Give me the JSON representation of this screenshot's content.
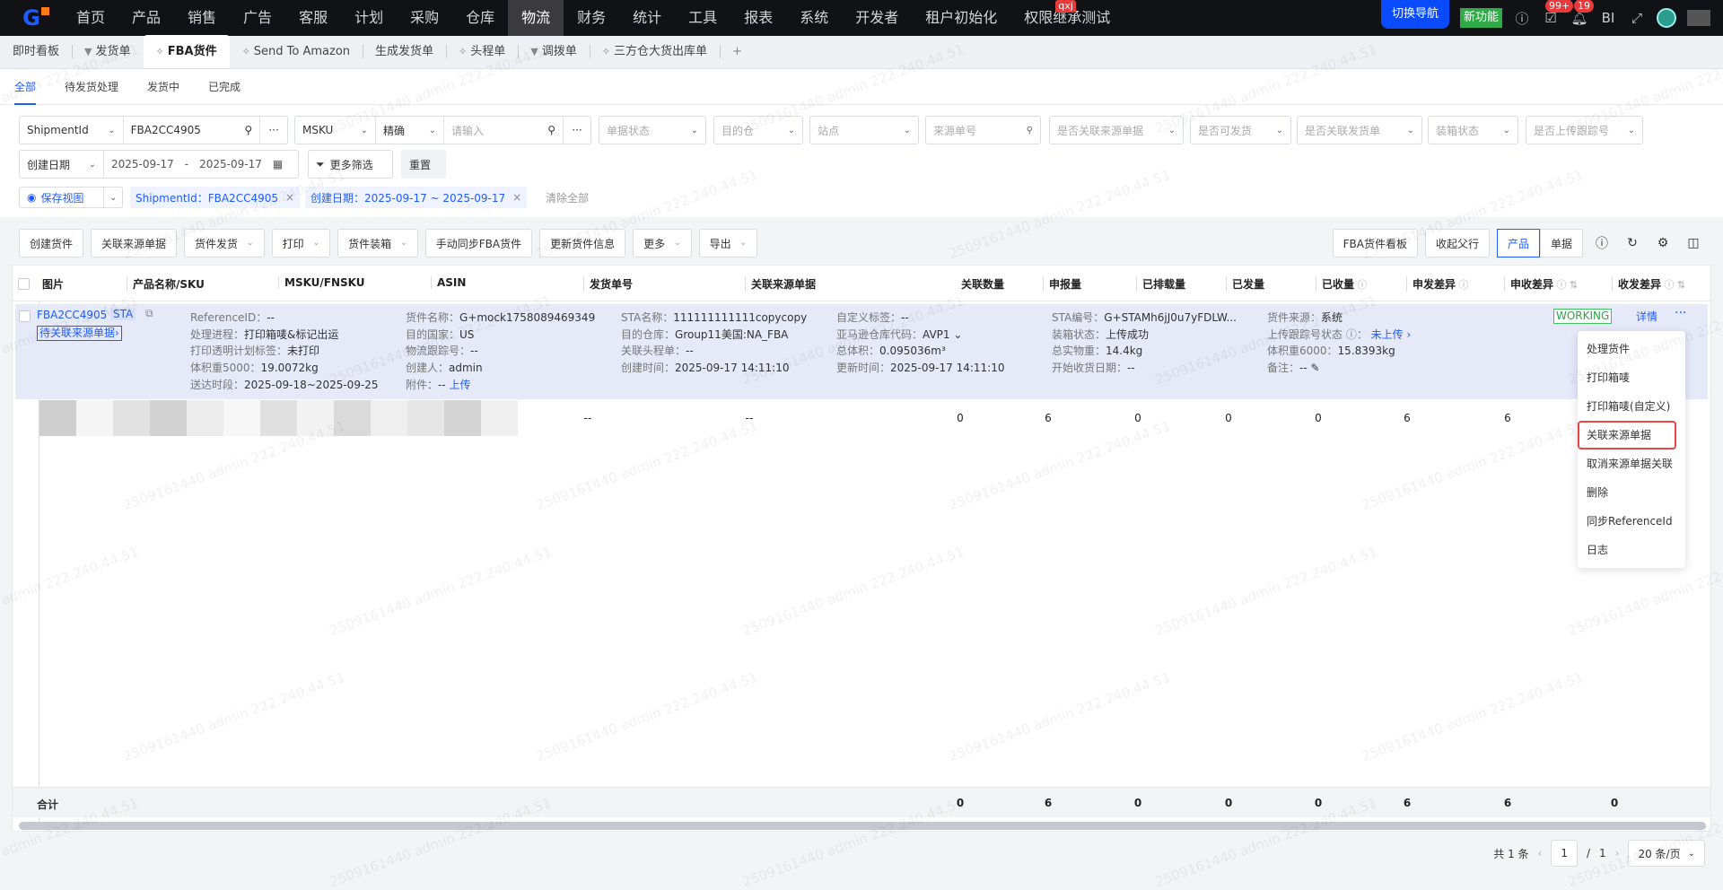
{
  "topnav": {
    "items": [
      "首页",
      "产品",
      "销售",
      "广告",
      "客服",
      "计划",
      "采购",
      "仓库",
      "物流",
      "财务",
      "统计",
      "工具",
      "报表",
      "系统",
      "开发者",
      "租户初始化",
      "权限继承测试"
    ],
    "active": "物流",
    "badge": "qxj",
    "switch_nav": "切换导航",
    "new_feature": "新功能",
    "task_badge": "99+",
    "bell_badge": "19",
    "bi": "BI"
  },
  "tabs": [
    {
      "label": "即时看板",
      "pin": ""
    },
    {
      "label": "发货单",
      "pin": "pinned"
    },
    {
      "label": "FBA货件",
      "pin": "pin",
      "active": true
    },
    {
      "label": "Send To Amazon",
      "pin": "pin"
    },
    {
      "label": "生成发货单",
      "pin": ""
    },
    {
      "label": "头程单",
      "pin": "pin"
    },
    {
      "label": "调拨单",
      "pin": "pinned"
    },
    {
      "label": "三方仓大货出库单",
      "pin": "pin"
    }
  ],
  "subtabs": [
    "全部",
    "待发货处理",
    "发货中",
    "已完成"
  ],
  "filters": {
    "id_type": "ShipmentId",
    "id_value": "FBA2CC4905",
    "msku_type": "MSKU",
    "match": "精确",
    "msku_placeholder": "请输入",
    "status": "单据状态",
    "warehouse": "目的仓",
    "site": "站点",
    "source_no": "来源单号",
    "linked_source": "是否关联来源单据",
    "can_ship": "是否可发货",
    "linked_ship": "是否关联发货单",
    "packing": "装箱状态",
    "tracking": "是否上传跟踪号",
    "date_type": "创建日期",
    "date_from": "2025-09-17",
    "date_sep": "-",
    "date_to": "2025-09-17",
    "more_filters": "更多筛选",
    "reset": "重置",
    "save_view": "保存视图",
    "chips": [
      "ShipmentId：FBA2CC4905",
      "创建日期：2025-09-17 ~ 2025-09-17"
    ],
    "clear_all": "清除全部"
  },
  "toolbar": {
    "buttons": [
      {
        "label": "创建货件",
        "dropdown": false
      },
      {
        "label": "关联来源单据",
        "dropdown": false
      },
      {
        "label": "货件发货",
        "dropdown": true
      },
      {
        "label": "打印",
        "dropdown": true
      },
      {
        "label": "货件装箱",
        "dropdown": true
      },
      {
        "label": "手动同步FBA货件",
        "dropdown": false
      },
      {
        "label": "更新货件信息",
        "dropdown": false
      },
      {
        "label": "更多",
        "dropdown": true
      },
      {
        "label": "导出",
        "dropdown": true
      }
    ],
    "board": "FBA货件看板",
    "collapse": "收起父行",
    "view_product": "产品",
    "view_doc": "单据"
  },
  "table": {
    "columns": [
      "图片",
      "产品名称/SKU",
      "MSKU/FNSKU",
      "ASIN",
      "发货单号",
      "关联来源单据",
      "关联数量",
      "申报量",
      "已排载量",
      "已发量",
      "已收量",
      "申发差异",
      "申收差异",
      "收发差异"
    ],
    "row": {
      "shipment_id": "FBA2CC4905",
      "tag": "STA",
      "pending": "待关联来源单据›",
      "details": [
        [
          {
            "l": "ReferenceID：",
            "v": "--"
          },
          {
            "l": "处理进程：",
            "v": "打印箱唛&标记出运"
          },
          {
            "l": "打印透明计划标签：",
            "v": "未打印"
          },
          {
            "l": "体积重5000：",
            "v": "19.0072kg"
          },
          {
            "l": "送达时段：",
            "v": "2025-09-18~2025-09-25"
          }
        ],
        [
          {
            "l": "货件名称：",
            "v": "G+mock1758089469349"
          },
          {
            "l": "目的国家：",
            "v": "US"
          },
          {
            "l": "物流跟踪号：",
            "v": "--"
          },
          {
            "l": "创建人：",
            "v": "admin"
          },
          {
            "l": "附件：",
            "v": "--",
            "link": "上传"
          }
        ],
        [
          {
            "l": "STA名称：",
            "v": "111111111111copycopy"
          },
          {
            "l": "目的仓库：",
            "v": "Group11美国:NA_FBA"
          },
          {
            "l": "关联头程单：",
            "v": "--"
          },
          {
            "l": "创建时间：",
            "v": "2025-09-17 14:11:10"
          }
        ],
        [
          {
            "l": "自定义标签：",
            "v": "--"
          },
          {
            "l": "亚马逊仓库代码：",
            "v": "AVP1 ⌄"
          },
          {
            "l": "总体积：",
            "v": "0.095036m³"
          },
          {
            "l": "更新时间：",
            "v": "2025-09-17 14:11:10"
          }
        ],
        [
          {
            "l": "STA编号：",
            "v": "G+STAMh6jJ0u7yFDLW..."
          },
          {
            "l": "装箱状态：",
            "v": "上传成功"
          },
          {
            "l": "总实物重：",
            "v": "14.4kg"
          },
          {
            "l": "开始收货日期：",
            "v": "--"
          }
        ],
        [
          {
            "l": "货件来源：",
            "v": "系统"
          },
          {
            "l": "上传跟踪号状态 ⓘ：",
            "v": "",
            "link": "未上传 ›"
          },
          {
            "l": "体积重6000：",
            "v": "15.8393kg"
          },
          {
            "l": "备注：",
            "v": "-- ✎"
          }
        ]
      ],
      "status": "WORKING",
      "detail": "详情",
      "more": "···"
    },
    "item": {
      "ship_no": "--",
      "source": "--",
      "values": [
        0,
        6,
        0,
        0,
        0,
        6,
        6
      ]
    },
    "total_label": "合计",
    "totals": [
      0,
      6,
      0,
      0,
      0,
      6,
      6,
      0
    ]
  },
  "menu": [
    "处理货件",
    "打印箱唛",
    "打印箱唛(自定义)",
    "关联来源单据",
    "取消来源单据关联",
    "删除",
    "同步ReferenceId",
    "日志"
  ],
  "menu_highlight": 3,
  "pager": {
    "total": "共 1 条",
    "page": "1",
    "sep": "/",
    "pages": "1",
    "size": "20 条/页"
  },
  "watermark": "2509161440 admin 222.240.44.51"
}
